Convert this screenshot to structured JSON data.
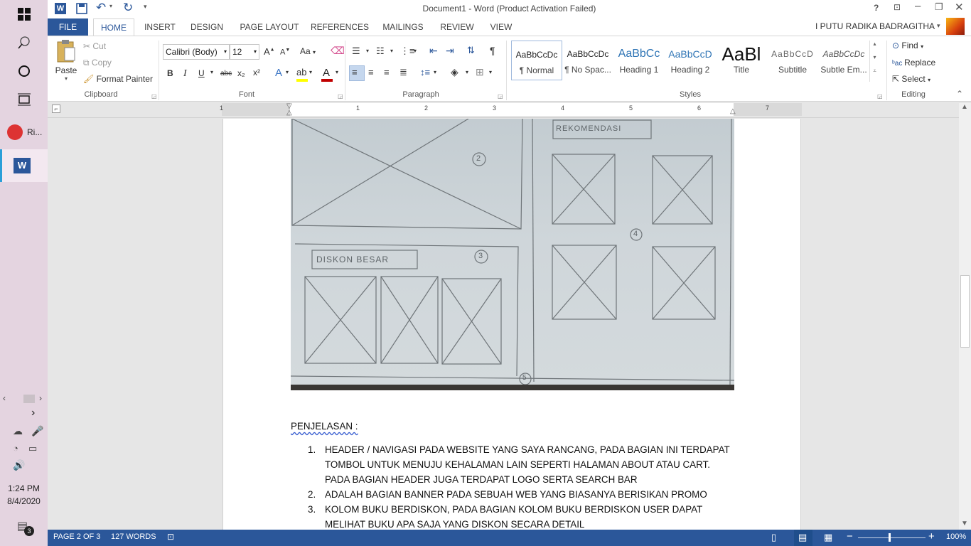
{
  "window": {
    "title": "Document1 - Word (Product Activation Failed)",
    "help": "?",
    "user": "I PUTU RADIKA BADRAGITHA"
  },
  "taskbar": {
    "apps": [
      {
        "label": "Ri...",
        "icon": "recorder-icon"
      },
      {
        "label": "",
        "icon": "word-icon"
      }
    ],
    "time": "1:24 PM",
    "date": "8/4/2020",
    "notifications": "3"
  },
  "tabs": [
    "FILE",
    "HOME",
    "INSERT",
    "DESIGN",
    "PAGE LAYOUT",
    "REFERENCES",
    "MAILINGS",
    "REVIEW",
    "VIEW"
  ],
  "active_tab": "HOME",
  "ribbon": {
    "clipboard": {
      "label": "Clipboard",
      "paste": "Paste",
      "cut": "Cut",
      "copy": "Copy",
      "format_painter": "Format Painter"
    },
    "font": {
      "label": "Font",
      "family": "Calibri (Body)",
      "size": "12",
      "change_case": "Aa",
      "bold": "B",
      "italic": "I",
      "underline": "U",
      "strike": "abc",
      "subscript": "x₂",
      "superscript": "x²",
      "font_color_hex": "#c00000",
      "highlight_hex": "#ffff00"
    },
    "paragraph": {
      "label": "Paragraph",
      "pilcrow": "¶"
    },
    "styles": {
      "label": "Styles",
      "items": [
        {
          "sample": "AaBbCcDc",
          "name": "¶ Normal"
        },
        {
          "sample": "AaBbCcDc",
          "name": "¶ No Spac..."
        },
        {
          "sample": "AaBbCc",
          "name": "Heading 1"
        },
        {
          "sample": "AaBbCcD",
          "name": "Heading 2"
        },
        {
          "sample": "AaBl",
          "name": "Title"
        },
        {
          "sample": "AaBbCcD",
          "name": "Subtitle"
        },
        {
          "sample": "AaBbCcDc",
          "name": "Subtle Em..."
        }
      ]
    },
    "editing": {
      "label": "Editing",
      "find": "Find",
      "replace": "Replace",
      "select": "Select"
    }
  },
  "ruler": {
    "numbers": [
      "1",
      "1",
      "2",
      "3",
      "4",
      "5",
      "6",
      "7"
    ]
  },
  "sketch": {
    "label_rekomendasi": "REKOMENDASI",
    "label_diskon": "DISKON BESAR",
    "marks": [
      "2",
      "3",
      "4",
      "5"
    ]
  },
  "document": {
    "heading": "PENJELASAN :",
    "list": [
      {
        "num": "1.",
        "lines": [
          "HEADER / NAVIGASI PADA WEBSITE YANG SAYA RANCANG, PADA BAGIAN INI TERDAPAT",
          "TOMBOL UNTUK MENUJU KEHALAMAN LAIN SEPERTI HALAMAN ABOUT ATAU CART.",
          "PADA BAGIAN HEADER JUGA TERDAPAT LOGO SERTA SEARCH BAR"
        ]
      },
      {
        "num": "2.",
        "lines": [
          "ADALAH BAGIAN BANNER PADA SEBUAH WEB YANG BIASANYA BERISIKAN PROMO"
        ]
      },
      {
        "num": "3.",
        "lines": [
          "KOLOM BUKU BERDISKON, PADA BAGIAN KOLOM BUKU BERDISKON USER DAPAT",
          "MELIHAT BUKU APA SAJA YANG DISKON SECARA DETAIL"
        ]
      }
    ]
  },
  "status": {
    "page": "PAGE 2 OF 3",
    "words": "127 WORDS",
    "zoom": "100%",
    "accent": "#2b579a"
  }
}
